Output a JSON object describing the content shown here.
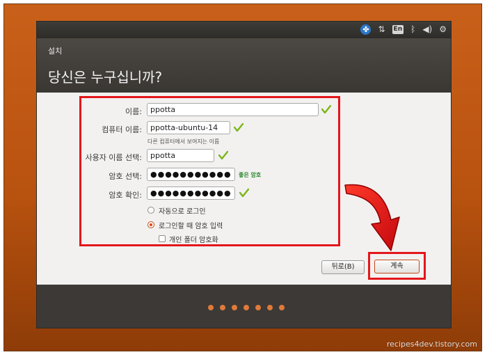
{
  "panel": {
    "icons": [
      "accessibility-icon",
      "network-icon",
      "keyboard-layout-icon",
      "bluetooth-icon",
      "volume-icon",
      "settings-icon"
    ],
    "keyboard_layout": "En"
  },
  "header": {
    "section": "설치",
    "title": "당신은 누구십니까?"
  },
  "form": {
    "name": {
      "label": "이름:",
      "value": "ppotta"
    },
    "computer_name": {
      "label": "컴퓨터 이름:",
      "value": "ppotta-ubuntu-14",
      "hint": "다른 컴퓨터에서 보여지는 이름"
    },
    "username": {
      "label": "사용자 이름 선택:",
      "value": "ppotta"
    },
    "password": {
      "label": "암호 선택:",
      "value": "●●●●●●●●●●●",
      "strength": "좋은 암호"
    },
    "confirm": {
      "label": "암호 확인:",
      "value": "●●●●●●●●●●●"
    },
    "auto_login": {
      "label": "자동으로 로그인",
      "selected": false
    },
    "require_password": {
      "label": "로그인할 때 암호 입력",
      "selected": true
    },
    "encrypt_home": {
      "label": "개인 폴더 암호화",
      "checked": false
    }
  },
  "buttons": {
    "back": "뒤로(B)",
    "continue": "계속"
  },
  "progress": {
    "total_steps": 7
  },
  "colors": {
    "accent": "#dd4814",
    "highlight": "#e3161b",
    "check": "#7cb518",
    "desktop": "#c9601a",
    "strength": "#2d8a2d"
  },
  "watermark": "recipes4dev.tistory.com"
}
